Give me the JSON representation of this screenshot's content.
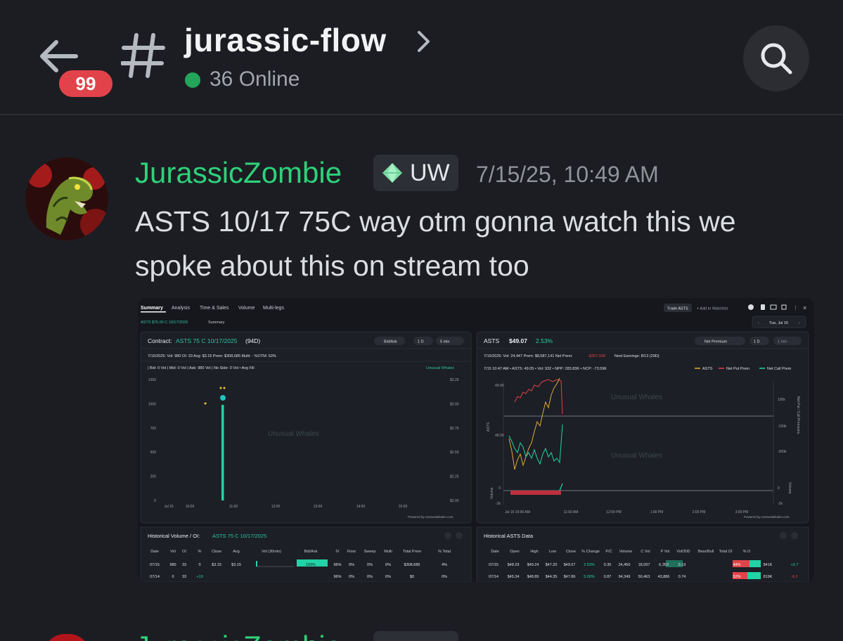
{
  "header": {
    "unread_count": "99",
    "channel_name": "jurassic-flow",
    "online_text": "36 Online",
    "icons": [
      "back-arrow-icon",
      "hash-icon",
      "chevron-right-icon",
      "search-icon"
    ],
    "online_color": "#23a55a"
  },
  "message": {
    "username": "JurassicZombie",
    "username_color": "#2ed17a",
    "tag": "UW",
    "timestamp": "7/15/25, 10:49 AM",
    "content": "ASTS 10/17 75C way otm gonna watch this we spoke about this on stream too"
  },
  "attachment": {
    "top_tabs": [
      "Summary",
      "Analysis",
      "Time & Sales",
      "Volume",
      "Multi-legs"
    ],
    "trade_button": "Trade ASTS",
    "watchlist": "+ Add to Watchlist",
    "contract_breadcrumb": "ASTS $75.00 C 10/17/2025",
    "breadcrumb_tail": "Summary",
    "date_picker": "Tue, Jul 15",
    "left_panel": {
      "title_prefix": "Contract:",
      "title_contract": "ASTS 75 C 10/17/2025",
      "title_suffix": "(94D)",
      "dropdowns": [
        "Bid/Ask",
        "1 D",
        "5 min"
      ],
      "stats": "7/15/2025:  Vol: 980   OI: 33   Avg: $3.15   Prem: $308,685   Multi: -   %OTM: 53%",
      "legend": "| Bid: 0 Vol   | Mid: 0 Vol   | Ask: 980 Vol   | No Side: 0 Vol   • Avg Fill",
      "brand": "Unusual Whales",
      "footer": "Powered by unusualwhales.com"
    },
    "right_panel": {
      "ticker": "ASTS",
      "price": "$49.07",
      "change": "2.53%",
      "dropdowns": [
        "Net Premium",
        "1 D",
        "1 min"
      ],
      "stats_prefix": "7/15/2025:   Vol: 24,447   Prem: $8,587,141   Net Prem:",
      "net_prem": "-$357,028",
      "stats_suffix": "Next Earnings: 8/13 (29D)",
      "tooltip": "7/15 10:47 AM • ASTS: 49.05 • Vol: 932 • NPP: 283.83K • NCP: -73.59K",
      "legend": [
        "ASTS",
        "Net Put Prem",
        "Net Call Prem"
      ],
      "footer": "Powered by unusualwhales.com"
    },
    "left_chart": {
      "y_left": [
        "1250",
        "1000",
        "750",
        "500",
        "250",
        "0"
      ],
      "y_right": [
        "$3.25",
        "$3.00",
        "$2.75",
        "$2.50",
        "$2.25",
        "$2.00"
      ],
      "x_ticks": [
        "Jul 15",
        "10:00",
        "11:00",
        "12:00",
        "13:00",
        "14:00",
        "15:00"
      ]
    },
    "right_chart": {
      "y_left_price": [
        "49.00",
        "48.00"
      ],
      "y_right_prem": [
        "100k",
        "-100k",
        "-300k"
      ],
      "y_vol": [
        "0",
        "-2k"
      ],
      "y_vol_right": [
        "0",
        "-2k"
      ],
      "x_ticks": [
        "Jul 15   10:00 AM",
        "11:00 AM",
        "12:00 PM",
        "1:00 PM",
        "2:00 PM",
        "3:00 PM"
      ],
      "y_axis_label_left": "ASTS",
      "y_axis_label_right": "Net Put / Call Premiums",
      "vol_label": "Volume"
    },
    "left_table": {
      "title_prefix": "Historical Volume / OI:",
      "title_contract": "ASTS 75 C 10/17/2025",
      "headers": [
        "Date",
        "Vol",
        "OI",
        "%",
        "Close",
        "Avg",
        "Vol (30min)",
        "Bid/Ask",
        "IV",
        "Floor",
        "Sweep",
        "Multi",
        "Total Prem",
        "% Total"
      ],
      "rows": [
        [
          "07/15",
          "980",
          "33",
          "0",
          "$3.15",
          "$3.15",
          "",
          "100%",
          "96%",
          "0%",
          "0%",
          "0%",
          "$308,685",
          "4%"
        ],
        [
          "07/14",
          "0",
          "33",
          "+19",
          "",
          "",
          "",
          "",
          "96%",
          "0%",
          "0%",
          "0%",
          "$0",
          "0%"
        ]
      ]
    },
    "right_table": {
      "title": "Historical ASTS Data",
      "headers": [
        "Date",
        "Open",
        "High",
        "Low",
        "Close",
        "% Change",
        "P/C",
        "Volume",
        "C Vol",
        "P Vol",
        "Vol/30D",
        "Bear/Bull",
        "Total OI",
        "% O"
      ],
      "rows": [
        [
          "07/15",
          "$48.29",
          "$49.24",
          "$47.20",
          "$49.07",
          "2.53%",
          "0.35",
          "24,450",
          "18,097",
          "6,353",
          "0.19",
          "44%",
          "841K",
          "+2.7"
        ],
        [
          "07/14",
          "$45.34",
          "$48.89",
          "$44.35",
          "$47.86",
          "5.00%",
          "0.87",
          "94,349",
          "50,463",
          "43,886",
          "0.74",
          "52%",
          "819K",
          "-6.2"
        ]
      ]
    }
  }
}
